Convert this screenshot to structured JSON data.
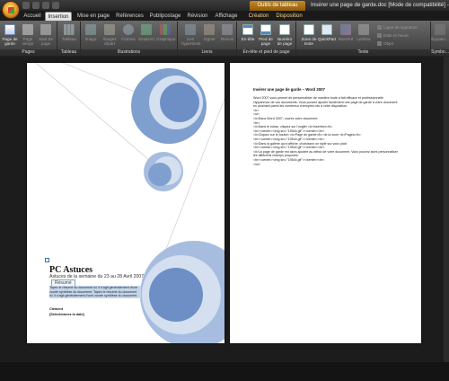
{
  "window": {
    "context_tab_title": "Outils de tableau",
    "document_title": "Insérer une page de garde.doc [Mode de compatibilité] -"
  },
  "tabs": [
    {
      "label": "Accueil"
    },
    {
      "label": "Insertion"
    },
    {
      "label": "Mise en page"
    },
    {
      "label": "Références"
    },
    {
      "label": "Publipostage"
    },
    {
      "label": "Révision"
    },
    {
      "label": "Affichage"
    },
    {
      "label": "Création"
    },
    {
      "label": "Disposition"
    }
  ],
  "ribbon": {
    "groups": {
      "pages": "Pages",
      "tableau": "Tableau",
      "illustrations": "Illustrations",
      "liens": "Liens",
      "entete": "En-tête et pied de page",
      "texte": "Texte",
      "symboles": "Symbo..."
    },
    "buttons": {
      "page_garde": "Page de garde",
      "page_vierge": "Page vierge",
      "saut_page": "Saut de page",
      "tableau": "Tableau",
      "image": "Image",
      "image_clipart": "Images clipart",
      "formes": "Formes",
      "smartart": "SmartArt",
      "graphique": "Graphique",
      "lien_hypertexte": "Lien hypertexte",
      "signet": "Signet",
      "renvoi": "Renvoi",
      "entete": "En-tête",
      "pied_page": "Pied de page",
      "numero_page": "Numéro de page",
      "zone_texte": "Zone de texte",
      "quickpart": "QuickPart",
      "wordart": "WordArt",
      "lettrine": "Lettrine",
      "ligne_signature": "Ligne de signature",
      "date_heure": "Date et heure",
      "objet": "Objet",
      "equation": "Équatio..."
    }
  },
  "page1": {
    "title": "PC Astuces",
    "subtitle": "Astuces de la semaine du 23 au 28 Avril 2007",
    "resume_label": "Résumé",
    "resume_text": "Tapez le résumé du document ici. Il s'agit généralement d'une courte synthèse du document. Tapez le résumé du document ici. Il s'agit généralement d'une courte synthèse du document.",
    "author": "Clément",
    "date": "[Sélectionnez la date]"
  },
  "page2": {
    "title": "Insérer une page de garde – Word 2007",
    "lines": [
      "Word 2007 vous permet de personnaliser de manière toute à fait efficace et professionnelle",
      "l'apparence de vos documents. Vous pouvez ajouter facilement une page de garde à votre document",
      "en piochant parmi les nombreux exemples mis à votre disposition.",
      "<b>",
      "<ul>",
      "<li>Dans Word 2007, ouvrez votre document.",
      "<br>",
      "<li>Dans le ruban, cliquez sur l'onglet <b>Insertion</b>.",
      "<br><center><img src=\"19544.gif\"></center><br>",
      "<li>Cliquez sur le bouton <b>Page de garde</b> de la zone <b>Pages</b>.",
      "<br><center><img src=\"19544.gif\"></center><br>",
      "<li>Dans la galerie qui s'affiche, choisissez un style sur vous plait.",
      "<br><center><img src=\"19544.gif\"></center><br>",
      "<li>La page de garde est alors ajoutée au début de votre document. Vous pouvez alors personnaliser",
      "les différents champs proposés.",
      "<br><center><img src=\"19544.gif\"></center><br>",
      "</ul>"
    ]
  },
  "colors": {
    "circle_dark": "#7f9fcf",
    "circle_mid": "#a7bde0",
    "circle_light": "#d4dff0",
    "circle_center": "#6e8fc6",
    "context_tab": "#c98a1f"
  }
}
